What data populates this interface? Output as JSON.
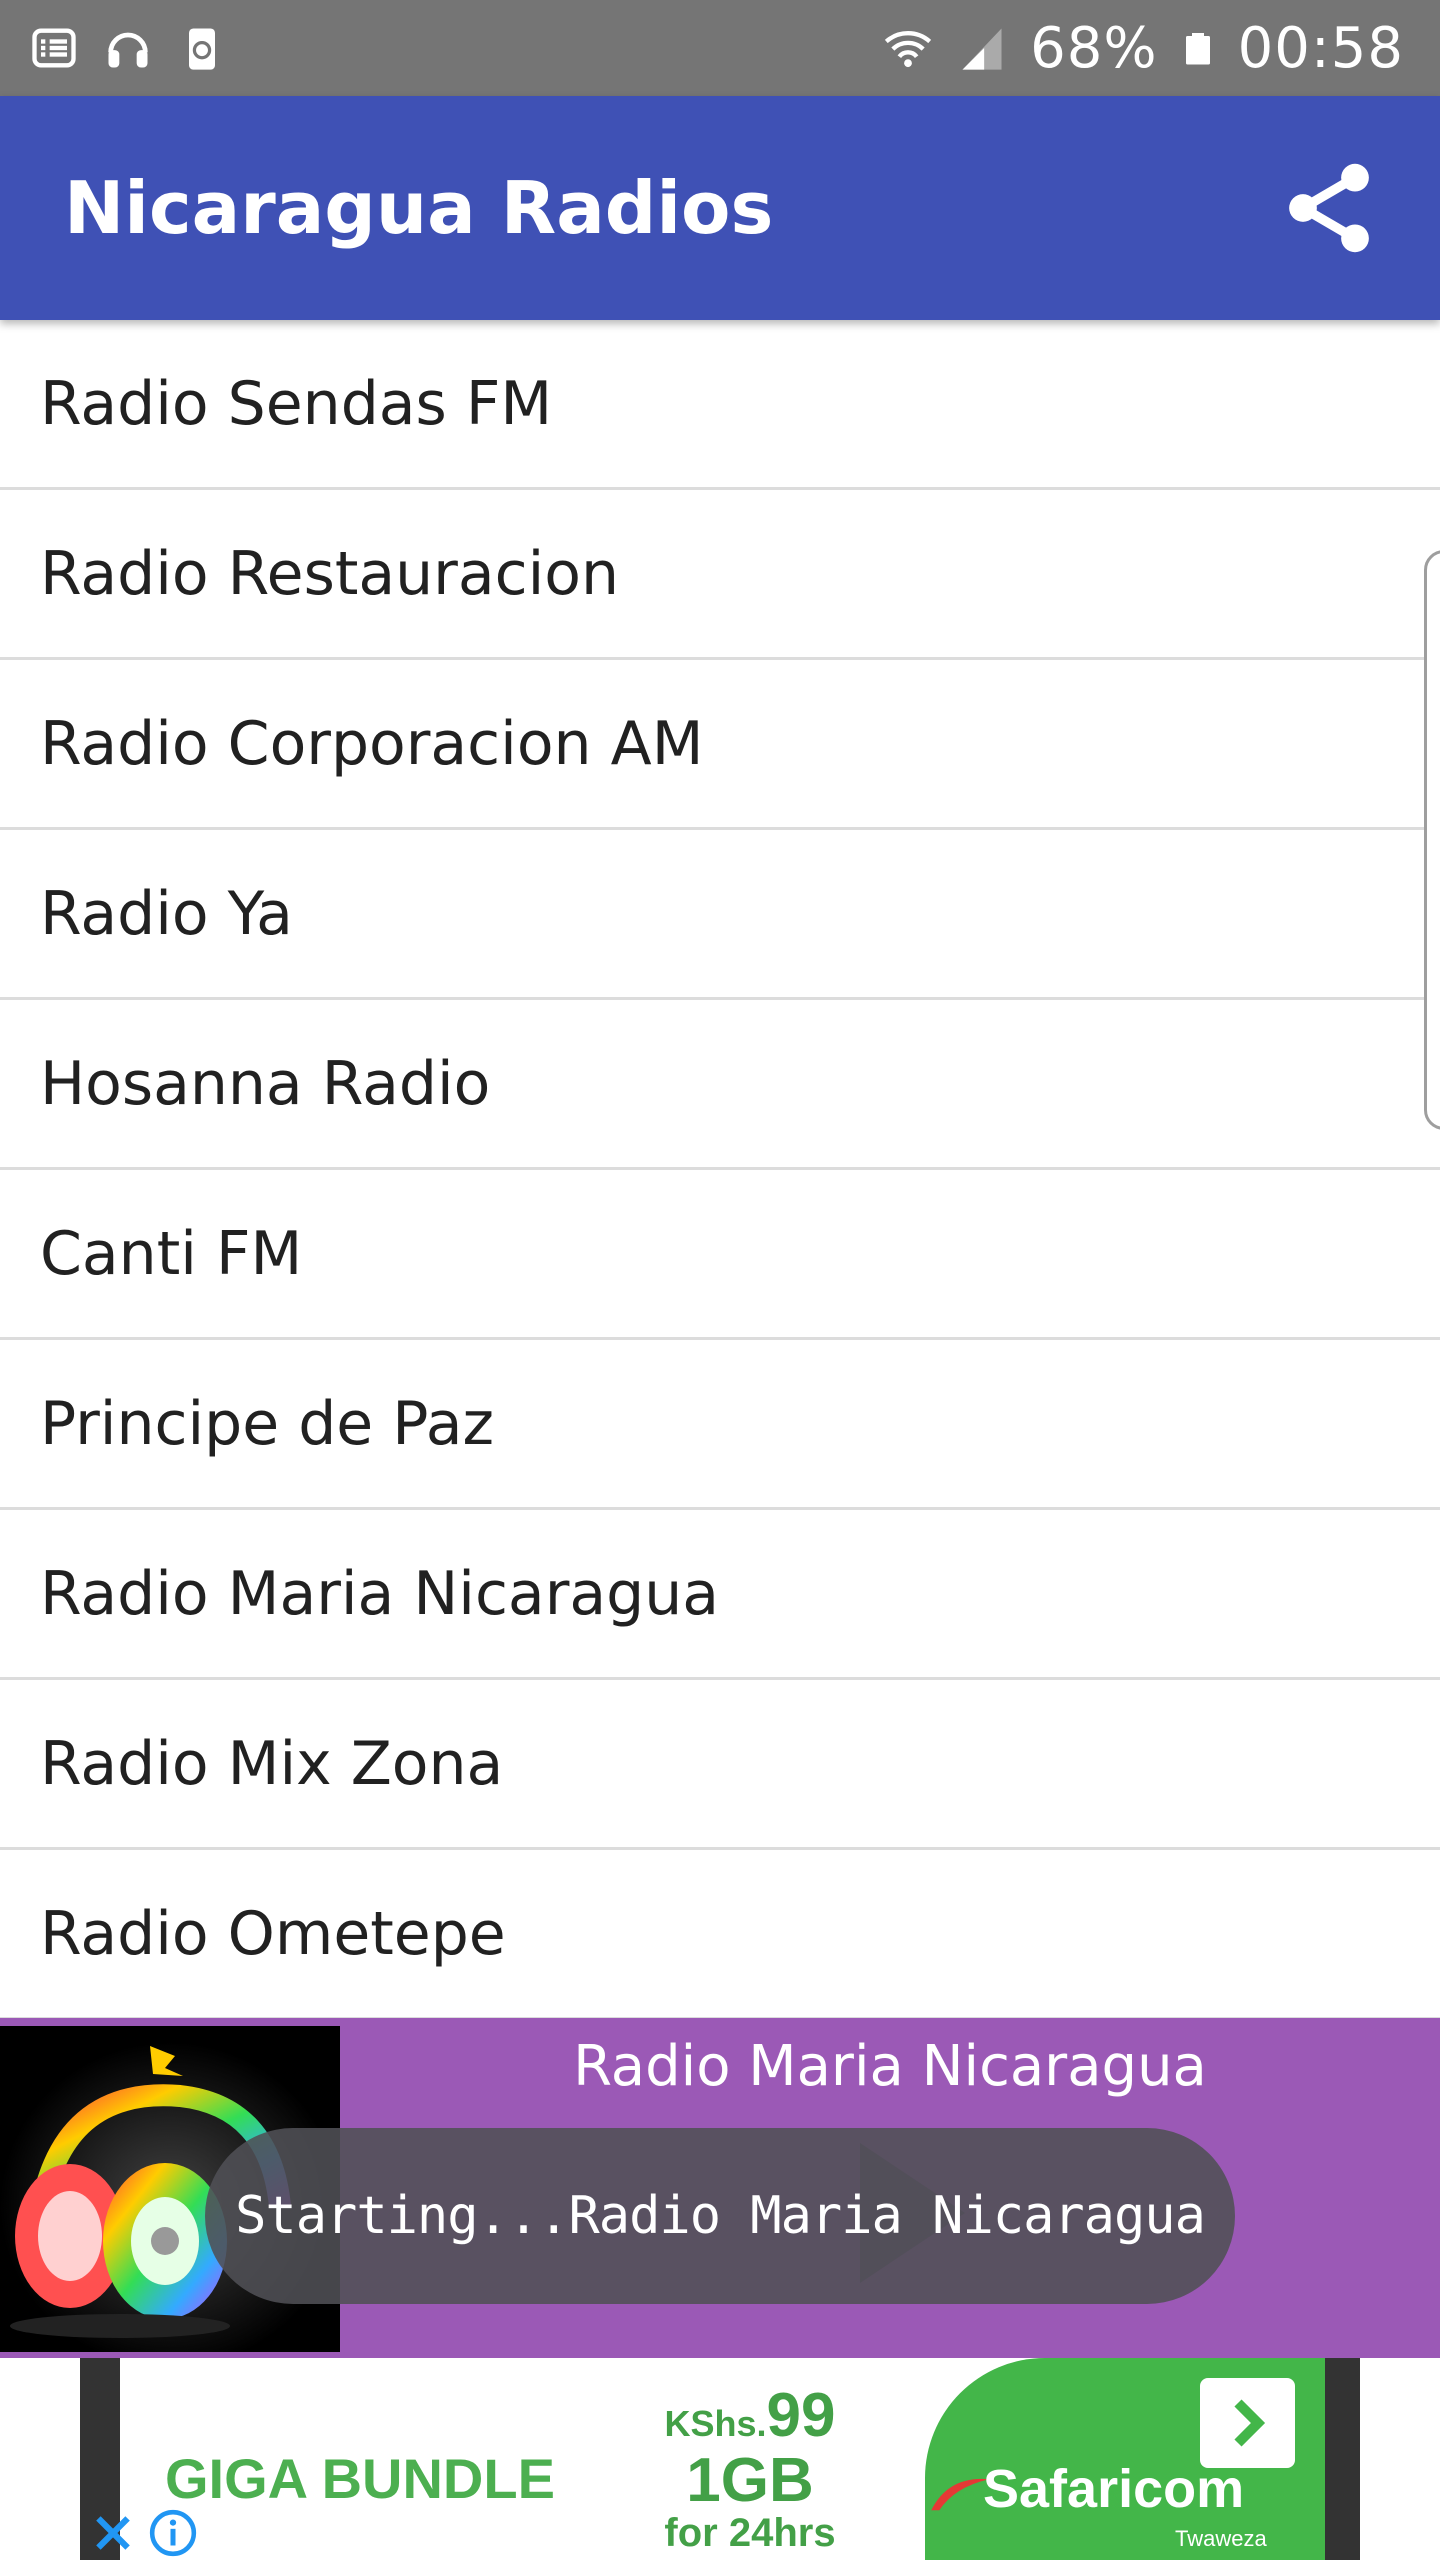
{
  "status_bar": {
    "battery": "68%",
    "time": "00:58",
    "icons": [
      "notification-list-icon",
      "headset-icon",
      "recycle-storage-icon",
      "wifi-icon",
      "signal-icon",
      "battery-icon"
    ]
  },
  "app_bar": {
    "title": "Nicaragua Radios",
    "share_icon": "share-icon",
    "color": "#3f51b5"
  },
  "stations": [
    {
      "label": "Radio Sendas FM"
    },
    {
      "label": "Radio Restauracion"
    },
    {
      "label": "Radio Corporacion AM"
    },
    {
      "label": "Radio Ya"
    },
    {
      "label": "Hosanna Radio"
    },
    {
      "label": "Canti FM"
    },
    {
      "label": "Principe de Paz"
    },
    {
      "label": "Radio Maria Nicaragua"
    },
    {
      "label": "Radio Mix Zona"
    },
    {
      "label": "Radio Ometepe"
    }
  ],
  "player": {
    "now_playing": "Radio Maria Nicaragua",
    "color": "#9b59b6",
    "art_icon": "rainbow-headphones-icon",
    "play_icon": "play-icon"
  },
  "toast": {
    "message": "Starting...Radio Maria Nicaragua"
  },
  "ad": {
    "headline": "GIGA BUNDLE",
    "currency": "KShs.",
    "price": "99",
    "volume": "1GB",
    "validity": "for 24hrs",
    "brand": "Safaricom",
    "tagline": "Twaweza",
    "brand_color": "#43b649",
    "close_icon": "close-icon",
    "info_icon": "info-icon",
    "arrow_icon": "chevron-right-icon"
  }
}
